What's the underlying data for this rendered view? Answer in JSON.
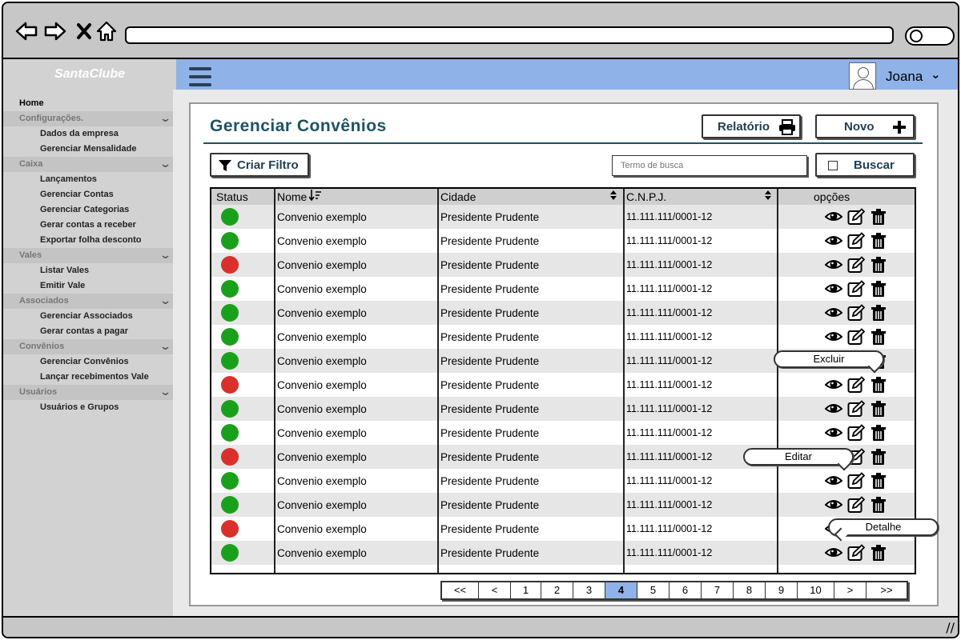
{
  "brand": "SantaClube",
  "user": {
    "name": "Joana"
  },
  "sidebar": [
    {
      "type": "top",
      "label": "Home"
    },
    {
      "type": "section",
      "label": "Configurações."
    },
    {
      "type": "sub",
      "label": "Dados da empresa"
    },
    {
      "type": "sub",
      "label": "Gerenciar Mensalidade"
    },
    {
      "type": "section",
      "label": "Caixa"
    },
    {
      "type": "sub",
      "label": "Lançamentos"
    },
    {
      "type": "sub",
      "label": "Gerenciar Contas"
    },
    {
      "type": "sub",
      "label": "Gerenciar Categorias"
    },
    {
      "type": "sub",
      "label": "Gerar contas a receber"
    },
    {
      "type": "sub",
      "label": "Exportar folha desconto"
    },
    {
      "type": "section",
      "label": "Vales"
    },
    {
      "type": "sub",
      "label": "Listar Vales"
    },
    {
      "type": "sub",
      "label": "Emitir Vale"
    },
    {
      "type": "section",
      "label": "Associados"
    },
    {
      "type": "sub",
      "label": "Gerenciar Associados"
    },
    {
      "type": "sub",
      "label": "Gerar contas a pagar"
    },
    {
      "type": "section",
      "label": "Convênios"
    },
    {
      "type": "sub",
      "label": "Gerenciar Convênios"
    },
    {
      "type": "sub",
      "label": "Lançar recebimentos Vale"
    },
    {
      "type": "section",
      "label": "Usuários"
    },
    {
      "type": "sub",
      "label": "Usuários e Grupos"
    }
  ],
  "page": {
    "title": "Gerenciar Convênios",
    "report_label": "Relatório",
    "new_label": "Novo",
    "filter_label": "Criar Filtro",
    "search_placeholder": "Termo de busca",
    "search_label": "Buscar"
  },
  "table": {
    "headers": {
      "status": "Status",
      "nome": "Nome",
      "cidade": "Cidade",
      "cnpj": "C.N.P.J.",
      "opcoes": "opções"
    },
    "status_colors": {
      "active": "#19a11c",
      "inactive": "#d9302c"
    },
    "rows": [
      {
        "status": "active",
        "nome": "Convenio exemplo",
        "cidade": "Presidente Prudente",
        "cnpj": "11.111.111/0001-12"
      },
      {
        "status": "active",
        "nome": "Convenio exemplo",
        "cidade": "Presidente Prudente",
        "cnpj": "11.111.111/0001-12"
      },
      {
        "status": "inactive",
        "nome": "Convenio exemplo",
        "cidade": "Presidente Prudente",
        "cnpj": "11.111.111/0001-12"
      },
      {
        "status": "active",
        "nome": "Convenio exemplo",
        "cidade": "Presidente Prudente",
        "cnpj": "11.111.111/0001-12"
      },
      {
        "status": "active",
        "nome": "Convenio exemplo",
        "cidade": "Presidente Prudente",
        "cnpj": "11.111.111/0001-12"
      },
      {
        "status": "active",
        "nome": "Convenio exemplo",
        "cidade": "Presidente Prudente",
        "cnpj": "11.111.111/0001-12"
      },
      {
        "status": "active",
        "nome": "Convenio exemplo",
        "cidade": "Presidente Prudente",
        "cnpj": "11.111.111/0001-12"
      },
      {
        "status": "inactive",
        "nome": "Convenio exemplo",
        "cidade": "Presidente Prudente",
        "cnpj": "11.111.111/0001-12"
      },
      {
        "status": "active",
        "nome": "Convenio exemplo",
        "cidade": "Presidente Prudente",
        "cnpj": "11.111.111/0001-12"
      },
      {
        "status": "active",
        "nome": "Convenio exemplo",
        "cidade": "Presidente Prudente",
        "cnpj": "11.111.111/0001-12"
      },
      {
        "status": "inactive",
        "nome": "Convenio exemplo",
        "cidade": "Presidente Prudente",
        "cnpj": "11.111.111/0001-12"
      },
      {
        "status": "active",
        "nome": "Convenio exemplo",
        "cidade": "Presidente Prudente",
        "cnpj": "11.111.111/0001-12"
      },
      {
        "status": "active",
        "nome": "Convenio exemplo",
        "cidade": "Presidente Prudente",
        "cnpj": "11.111.111/0001-12"
      },
      {
        "status": "inactive",
        "nome": "Convenio exemplo",
        "cidade": "Presidente Prudente",
        "cnpj": "11.111.111/0001-12"
      },
      {
        "status": "active",
        "nome": "Convenio exemplo",
        "cidade": "Presidente Prudente",
        "cnpj": "11.111.111/0001-12"
      }
    ]
  },
  "tooltips": {
    "excluir": "Excluir",
    "editar": "Editar",
    "detalhe": "Detalhe"
  },
  "pagination": {
    "items": [
      "<<",
      "<",
      "1",
      "2",
      "3",
      "4",
      "5",
      "6",
      "7",
      "8",
      "9",
      "10",
      ">",
      ">>"
    ],
    "active": "4"
  }
}
